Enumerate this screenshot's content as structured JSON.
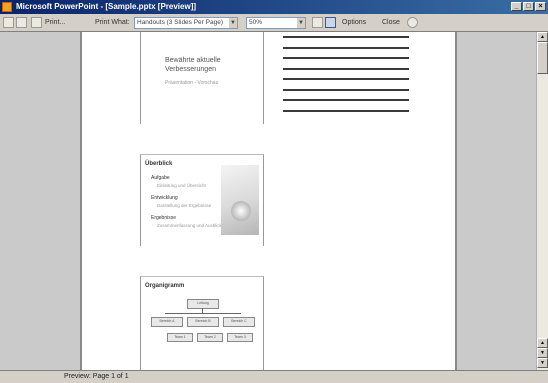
{
  "window": {
    "title": "Microsoft PowerPoint - [Sample.pptx [Preview]]",
    "controls": [
      "_",
      "□",
      "×"
    ]
  },
  "toolbar": {
    "print_label": "Print...",
    "options_label": "Print What:",
    "print_what_value": "Handouts (3 Slides Per Page)",
    "zoom_value": "50%",
    "options_button": "Options",
    "close_button": "Close"
  },
  "preview": {
    "slide1": {
      "title": "Bewährte aktuelle Verbesserungen",
      "subtitle": "Präsentation - Vorschau"
    },
    "slide2": {
      "heading": "Überblick",
      "bullets": [
        {
          "label": "Aufgabe",
          "sub": "Einleitung und Übersicht"
        },
        {
          "label": "Entwicklung",
          "sub": "Darstellung der Ergebnisse"
        },
        {
          "label": "Ergebnisse",
          "sub": "Zusammenfassung und Ausblick"
        }
      ]
    },
    "slide3": {
      "heading": "Organigramm",
      "org_top": "Leitung",
      "org_mid": [
        "Bereich A",
        "Bereich B",
        "Bereich C"
      ],
      "org_low": [
        "Team 1",
        "Team 2",
        "Team 3"
      ]
    }
  },
  "statusbar": {
    "text": "Preview: Page 1 of 1"
  },
  "colors": {
    "titlebar_start": "#0a246a",
    "titlebar_end": "#3a6ea5",
    "chrome": "#d4d0c8",
    "margin_gray": "#cacaca"
  }
}
